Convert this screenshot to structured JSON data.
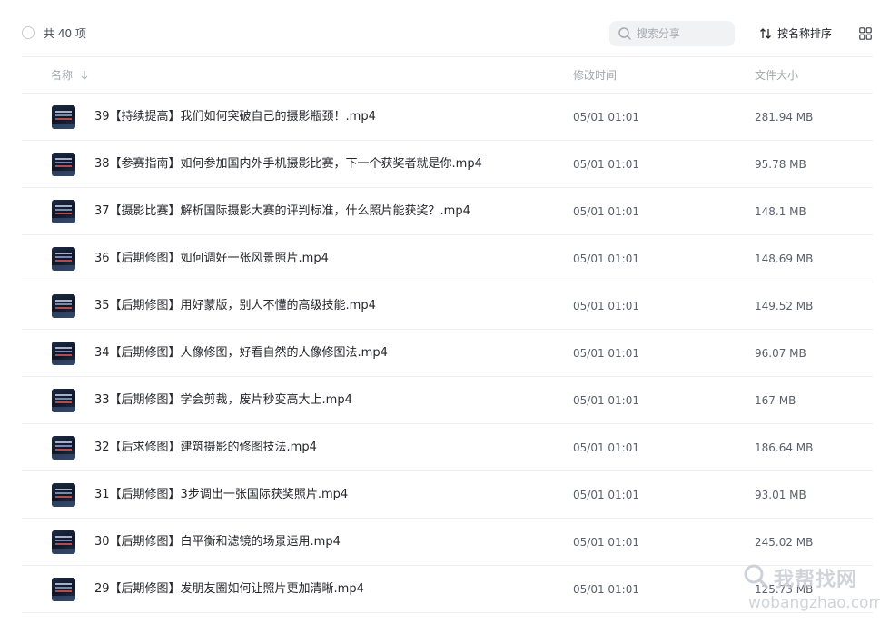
{
  "toolbar": {
    "count_label": "共 40 项",
    "search_placeholder": "搜索分享",
    "sort_label": "按名称排序"
  },
  "columns": {
    "name": "名称",
    "modified": "修改时间",
    "size": "文件大小"
  },
  "files": [
    {
      "name": "39【持续提高】我们如何突破自己的摄影瓶颈！.mp4",
      "modified": "05/01 01:01",
      "size": "281.94 MB"
    },
    {
      "name": "38【参赛指南】如何参加国内外手机摄影比赛，下一个获奖者就是你.mp4",
      "modified": "05/01 01:01",
      "size": "95.78 MB"
    },
    {
      "name": "37【摄影比赛】解析国际摄影大赛的评判标准，什么照片能获奖？.mp4",
      "modified": "05/01 01:01",
      "size": "148.1 MB"
    },
    {
      "name": "36【后期修图】如何调好一张风景照片.mp4",
      "modified": "05/01 01:01",
      "size": "148.69 MB"
    },
    {
      "name": "35【后期修图】用好蒙版，别人不懂的高级技能.mp4",
      "modified": "05/01 01:01",
      "size": "149.52 MB"
    },
    {
      "name": "34【后期修图】人像修图，好看自然的人像修图法.mp4",
      "modified": "05/01 01:01",
      "size": "96.07 MB"
    },
    {
      "name": "33【后期修图】学会剪裁，废片秒变高大上.mp4",
      "modified": "05/01 01:01",
      "size": "167 MB"
    },
    {
      "name": "32【后求修图】建筑摄影的修图技法.mp4",
      "modified": "05/01 01:01",
      "size": "186.64 MB"
    },
    {
      "name": "31【后期修图】3步调出一张国际获奖照片.mp4",
      "modified": "05/01 01:01",
      "size": "93.01 MB"
    },
    {
      "name": "30【后期修图】白平衡和滤镜的场景运用.mp4",
      "modified": "05/01 01:01",
      "size": "245.02 MB"
    },
    {
      "name": "29【后期修图】发朋友圈如何让照片更加清晰.mp4",
      "modified": "05/01 01:01",
      "size": "125.73 MB"
    }
  ],
  "watermark": {
    "text_cn": "我帮找网",
    "text_en": "wobangzhao.com"
  },
  "colors": {
    "text_primary": "#25262b",
    "text_secondary": "#5a606b",
    "text_muted": "#a2a6ae",
    "divider": "#eceef2",
    "search_bg": "#f1f2f4"
  },
  "icons": {
    "search": "search-icon",
    "sort": "sort-icon",
    "grid": "grid-view-icon",
    "sort_arrow": "arrow-down-icon",
    "thumbnail": "video-thumbnail"
  }
}
